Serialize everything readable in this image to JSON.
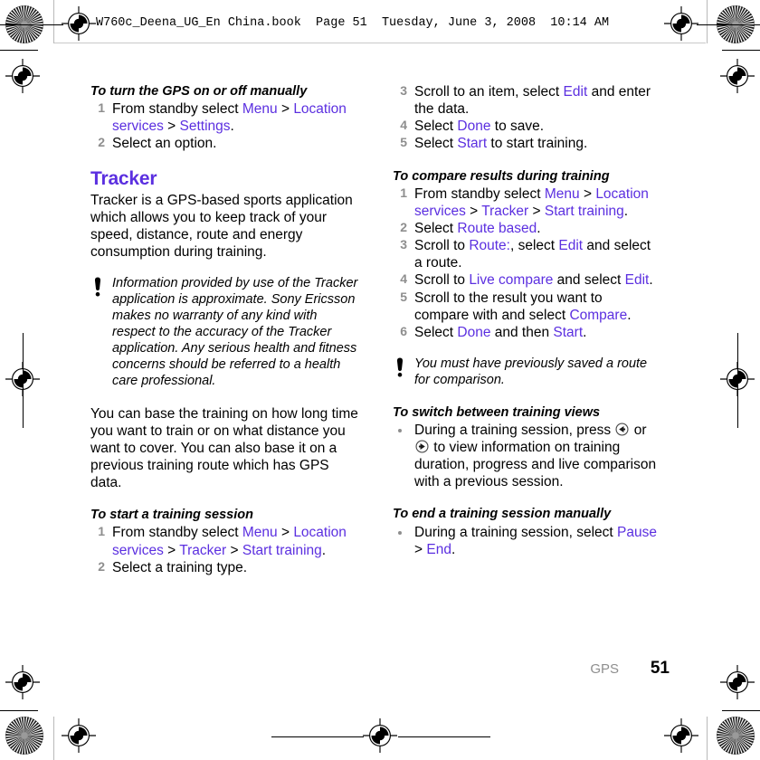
{
  "header": {
    "text": "W760c_Deena_UG_En China.book  Page 51  Tuesday, June 3, 2008  10:14 AM"
  },
  "colors": {
    "accent": "#5B2FE0",
    "step_number": "#8e8e8e",
    "body_text": "#000000",
    "footer_chapter": "#8e8e8e"
  },
  "left_column": {
    "proc1": {
      "heading": "To turn the GPS on or off manually",
      "steps": [
        {
          "num": "1",
          "parts": [
            {
              "t": "From standby select ",
              "ui": false
            },
            {
              "t": "Menu",
              "ui": true
            },
            {
              "t": " > ",
              "ui": false
            },
            {
              "t": "Location services",
              "ui": true
            },
            {
              "t": " > ",
              "ui": false
            },
            {
              "t": "Settings",
              "ui": true
            },
            {
              "t": ".",
              "ui": false
            }
          ]
        },
        {
          "num": "2",
          "parts": [
            {
              "t": "Select an option.",
              "ui": false
            }
          ]
        }
      ]
    },
    "section": {
      "heading": "Tracker",
      "paragraph": "Tracker is a GPS-based sports application which allows you to keep track of your speed, distance, route and energy consumption during training."
    },
    "note": {
      "icon": "exclamation-icon",
      "text": "Information provided by use of the Tracker application is approximate. Sony Ericsson makes no warranty of any kind with respect to the accuracy of the Tracker application. Any serious health and fitness concerns should be referred to a health care professional."
    },
    "paragraph2": "You can base the training on how long time you want to train or on what distance you want to cover. You can also base it on a previous training route which has GPS data.",
    "proc2": {
      "heading": "To start a training session",
      "steps": [
        {
          "num": "1",
          "parts": [
            {
              "t": "From standby select ",
              "ui": false
            },
            {
              "t": "Menu",
              "ui": true
            },
            {
              "t": " > ",
              "ui": false
            },
            {
              "t": "Location services",
              "ui": true
            },
            {
              "t": " > ",
              "ui": false
            },
            {
              "t": "Tracker",
              "ui": true
            },
            {
              "t": " > ",
              "ui": false
            },
            {
              "t": "Start training",
              "ui": true
            },
            {
              "t": ".",
              "ui": false
            }
          ]
        },
        {
          "num": "2",
          "parts": [
            {
              "t": "Select a training type.",
              "ui": false
            }
          ]
        }
      ]
    }
  },
  "right_column": {
    "proc2_cont": {
      "steps": [
        {
          "num": "3",
          "parts": [
            {
              "t": "Scroll to an item, select ",
              "ui": false
            },
            {
              "t": "Edit",
              "ui": true
            },
            {
              "t": " and enter the data.",
              "ui": false
            }
          ]
        },
        {
          "num": "4",
          "parts": [
            {
              "t": "Select ",
              "ui": false
            },
            {
              "t": "Done",
              "ui": true
            },
            {
              "t": " to save.",
              "ui": false
            }
          ]
        },
        {
          "num": "5",
          "parts": [
            {
              "t": "Select ",
              "ui": false
            },
            {
              "t": "Start",
              "ui": true
            },
            {
              "t": " to start training.",
              "ui": false
            }
          ]
        }
      ]
    },
    "proc3": {
      "heading": "To compare results during training",
      "steps": [
        {
          "num": "1",
          "parts": [
            {
              "t": "From standby select ",
              "ui": false
            },
            {
              "t": "Menu",
              "ui": true
            },
            {
              "t": " > ",
              "ui": false
            },
            {
              "t": "Location services",
              "ui": true
            },
            {
              "t": " > ",
              "ui": false
            },
            {
              "t": "Tracker",
              "ui": true
            },
            {
              "t": " > ",
              "ui": false
            },
            {
              "t": "Start training",
              "ui": true
            },
            {
              "t": ".",
              "ui": false
            }
          ]
        },
        {
          "num": "2",
          "parts": [
            {
              "t": "Select ",
              "ui": false
            },
            {
              "t": "Route based",
              "ui": true
            },
            {
              "t": ".",
              "ui": false
            }
          ]
        },
        {
          "num": "3",
          "parts": [
            {
              "t": "Scroll to ",
              "ui": false
            },
            {
              "t": "Route:",
              "ui": true
            },
            {
              "t": ", select ",
              "ui": false
            },
            {
              "t": "Edit",
              "ui": true
            },
            {
              "t": " and select a route.",
              "ui": false
            }
          ]
        },
        {
          "num": "4",
          "parts": [
            {
              "t": "Scroll to ",
              "ui": false
            },
            {
              "t": "Live compare",
              "ui": true
            },
            {
              "t": " and select ",
              "ui": false
            },
            {
              "t": "Edit",
              "ui": true
            },
            {
              "t": ".",
              "ui": false
            }
          ]
        },
        {
          "num": "5",
          "parts": [
            {
              "t": "Scroll to the result you want to compare with and select ",
              "ui": false
            },
            {
              "t": "Compare",
              "ui": true
            },
            {
              "t": ".",
              "ui": false
            }
          ]
        },
        {
          "num": "6",
          "parts": [
            {
              "t": "Select ",
              "ui": false
            },
            {
              "t": "Done",
              "ui": true
            },
            {
              "t": " and then ",
              "ui": false
            },
            {
              "t": "Start",
              "ui": true
            },
            {
              "t": ".",
              "ui": false
            }
          ]
        }
      ]
    },
    "note": {
      "icon": "exclamation-icon",
      "text": "You must have previously saved a route for comparison."
    },
    "proc4": {
      "heading": "To switch between training views",
      "bullet_parts_a": [
        {
          "t": "During a training session, press ",
          "ui": false
        }
      ],
      "icon_left": "nav-key-left-icon",
      "bullet_parts_b": [
        {
          "t": " or ",
          "ui": false
        }
      ],
      "icon_right": "nav-key-right-icon",
      "bullet_parts_c": [
        {
          "t": " to view information on training duration, progress and live comparison with a previous session.",
          "ui": false
        }
      ]
    },
    "proc5": {
      "heading": "To end a training session manually",
      "bullet_parts": [
        {
          "t": "During a training session, select ",
          "ui": false
        },
        {
          "t": "Pause",
          "ui": true
        },
        {
          "t": " > ",
          "ui": false
        },
        {
          "t": "End",
          "ui": true
        },
        {
          "t": ".",
          "ui": false
        }
      ]
    }
  },
  "footer": {
    "chapter": "GPS",
    "page_number": "51"
  }
}
